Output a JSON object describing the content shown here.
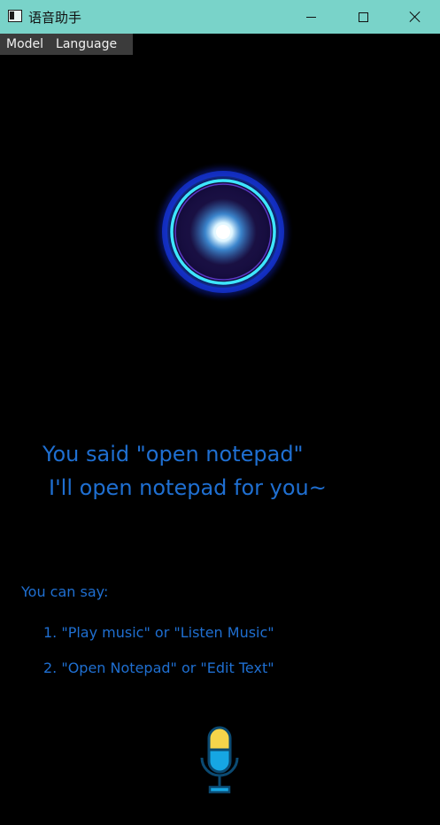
{
  "window": {
    "title": "语音助手",
    "controls": {
      "minimize": "minimize",
      "maximize": "maximize",
      "close": "close"
    }
  },
  "menu": [
    "Model",
    "Language"
  ],
  "assistant": {
    "response_line1": "You said \"open notepad\"",
    "response_line2": "I'll open notepad for you~"
  },
  "hints": {
    "title": "You can say:",
    "items": [
      "1. \"Play music\" or \"Listen Music\"",
      "2. \"Open Notepad\" or \"Edit Text\""
    ]
  },
  "colors": {
    "titlebar": "#79d3c9",
    "text_accent": "#1f6fd1",
    "mic_top": "#f6d54a",
    "mic_bottom": "#16a6e3",
    "mic_outline": "#0b4a72"
  }
}
